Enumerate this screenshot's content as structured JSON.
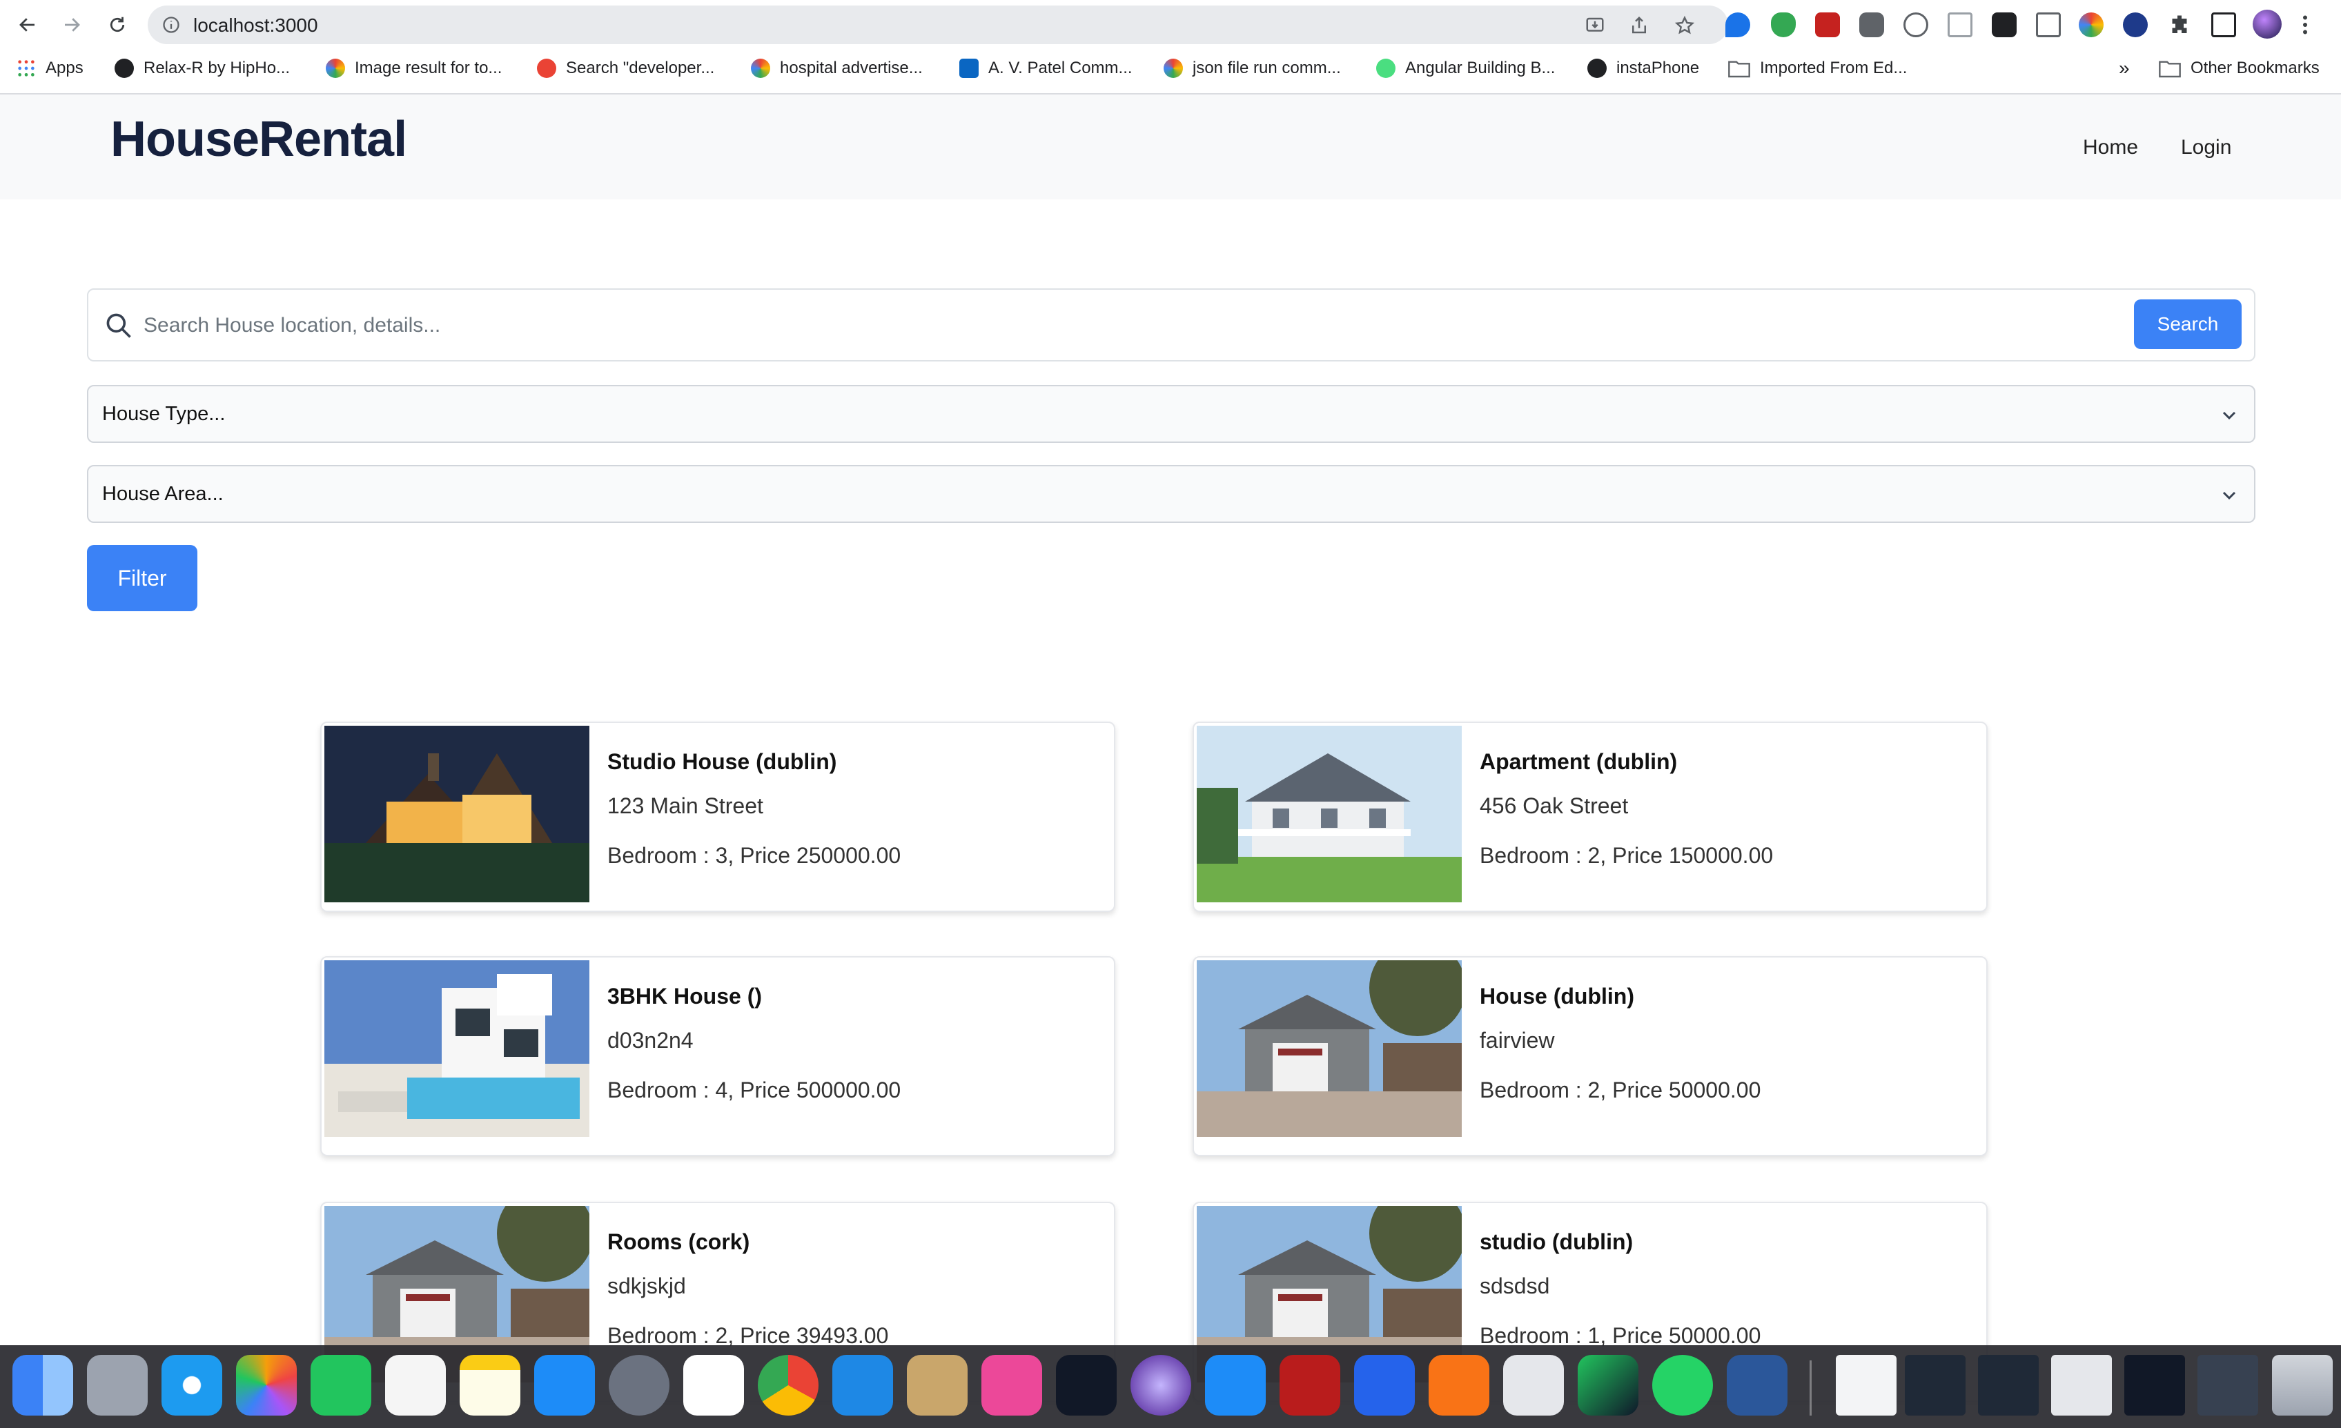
{
  "browser": {
    "url": "localhost:3000",
    "bookmarks": [
      "Apps",
      "Relax-R  by HipHo...",
      "Image result for to...",
      "Search \"developer...",
      "hospital advertise...",
      "A. V. Patel Comm...",
      "json file run comm...",
      "Angular Building B...",
      "instaPhone",
      "Imported From Ed...",
      "Other Bookmarks"
    ],
    "overflow": "»"
  },
  "header": {
    "logo": "HouseRental",
    "nav": [
      "Home",
      "Login"
    ]
  },
  "search": {
    "placeholder": "Search House location, details...",
    "button": "Search"
  },
  "filters": {
    "house_type": "House Type...",
    "house_area": "House Area...",
    "button": "Filter"
  },
  "listings": [
    {
      "title": "Studio House (dublin)",
      "address": "123 Main Street",
      "meta": "Bedroom : 3, Price 250000.00"
    },
    {
      "title": "Apartment (dublin)",
      "address": "456 Oak Street",
      "meta": "Bedroom : 2, Price 150000.00"
    },
    {
      "title": "3BHK House ()",
      "address": "d03n2n4",
      "meta": "Bedroom : 4, Price 500000.00"
    },
    {
      "title": "House (dublin)",
      "address": "fairview",
      "meta": "Bedroom : 2, Price 50000.00"
    },
    {
      "title": "Rooms (cork)",
      "address": "sdkjskjd",
      "meta": "Bedroom : 2, Price 39493.00"
    },
    {
      "title": "studio (dublin)",
      "address": "sdsdsd",
      "meta": "Bedroom : 1, Price 50000.00"
    }
  ],
  "colors": {
    "primary": "#3b82f6",
    "logo": "#16213e",
    "header_bg": "#f8f9fa"
  }
}
